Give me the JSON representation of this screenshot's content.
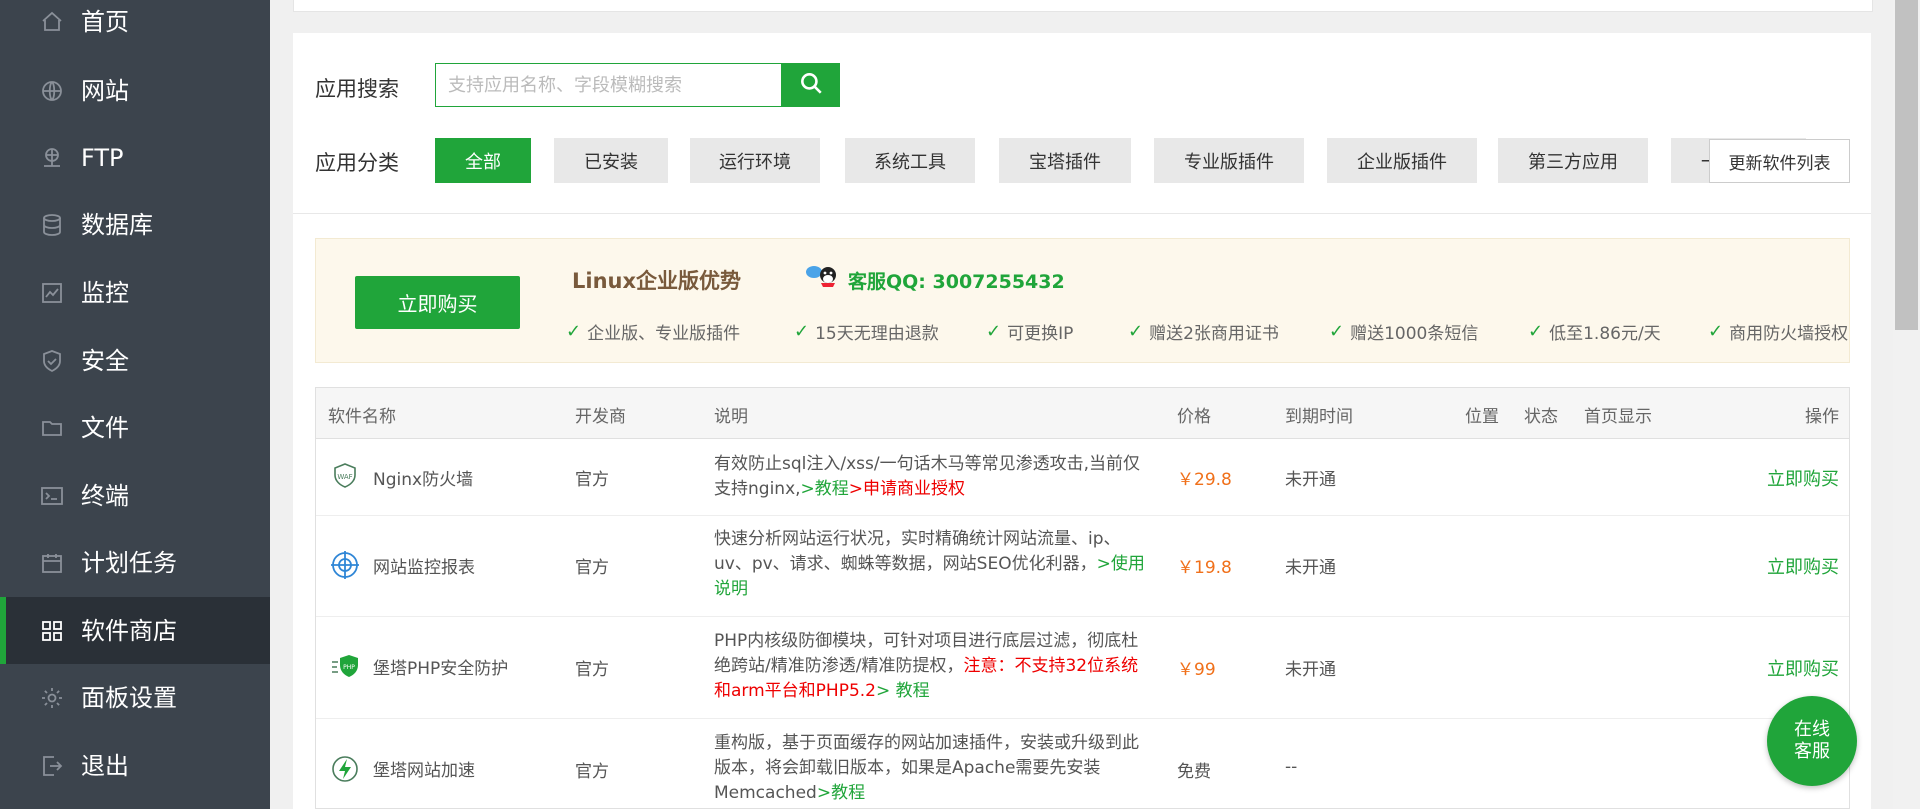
{
  "sidebar": {
    "items": [
      {
        "label": "首页",
        "icon": "home-icon"
      },
      {
        "label": "网站",
        "icon": "globe-icon"
      },
      {
        "label": "FTP",
        "icon": "ftp-icon"
      },
      {
        "label": "数据库",
        "icon": "database-icon"
      },
      {
        "label": "监控",
        "icon": "monitor-icon"
      },
      {
        "label": "安全",
        "icon": "shield-icon"
      },
      {
        "label": "文件",
        "icon": "folder-icon"
      },
      {
        "label": "终端",
        "icon": "terminal-icon"
      },
      {
        "label": "计划任务",
        "icon": "calendar-icon"
      },
      {
        "label": "软件商店",
        "icon": "grid-icon",
        "active": true
      },
      {
        "label": "面板设置",
        "icon": "gear-icon"
      },
      {
        "label": "退出",
        "icon": "logout-icon"
      }
    ]
  },
  "search": {
    "label": "应用搜索",
    "placeholder": "支持应用名称、字段模糊搜索",
    "value": ""
  },
  "category": {
    "label": "应用分类",
    "tabs": [
      "全部",
      "已安装",
      "运行环境",
      "系统工具",
      "宝塔插件",
      "专业版插件",
      "企业版插件",
      "第三方应用",
      "一键部署"
    ],
    "active_index": 0,
    "update_label": "更新软件列表"
  },
  "promo": {
    "buy_label": "立即购买",
    "title": "Linux企业版优势",
    "qq_text": "客服QQ: 3007255432",
    "features": [
      "企业版、专业版插件",
      "15天无理由退款",
      "可更换IP",
      "赠送2张商用证书",
      "赠送1000条短信",
      "低至1.86元/天",
      "商用防火墙授权"
    ]
  },
  "table": {
    "headers": [
      "软件名称",
      "开发商",
      "说明",
      "价格",
      "到期时间",
      "位置",
      "状态",
      "首页显示",
      "操作"
    ],
    "rows": [
      {
        "name": "Nginx防火墙",
        "icon": "waf-icon",
        "developer": "官方",
        "desc": "有效防止sql注入/xss/一句话木马等常见渗透攻击,当前仅支持nginx,",
        "link1": ">教程",
        "link2": ">申请商业授权",
        "price": "￥29.8",
        "expire": "未开通",
        "action": "立即购买"
      },
      {
        "name": "网站监控报表",
        "icon": "target-icon",
        "developer": "官方",
        "desc": "快速分析网站运行状况，实时精确统计网站流量、ip、uv、pv、请求、蜘蛛等数据，网站SEO优化利器，",
        "link1": ">使用说明",
        "price": "￥19.8",
        "expire": "未开通",
        "action": "立即购买"
      },
      {
        "name": "堡塔PHP安全防护",
        "icon": "php-shield-icon",
        "developer": "官方",
        "desc": "PHP内核级防御模块，可针对项目进行底层过滤，彻底杜绝跨站/精准防渗透/精准防提权，",
        "warn": "注意：不支持32位系统和arm平台和PHP5.2",
        "link1": "> 教程",
        "price": "￥99",
        "expire": "未开通",
        "action": "立即购买"
      },
      {
        "name": "堡塔网站加速",
        "icon": "bolt-icon",
        "developer": "官方",
        "desc": "重构版，基于页面缓存的网站加速插件，安装或升级到此版本，将会卸载旧版本，如果是Apache需要先安装Memcached",
        "link1": ">教程",
        "price": "免费",
        "expire": "--",
        "action": ""
      }
    ]
  },
  "chat": {
    "line1": "在线",
    "line2": "客服"
  },
  "colors": {
    "brand": "#20a53a",
    "sidebar": "#3c444d",
    "price": "#f0701a",
    "warning": "#ee0000"
  }
}
